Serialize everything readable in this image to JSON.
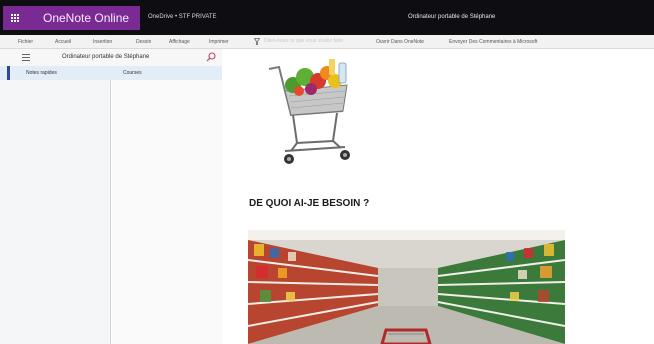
{
  "appbar": {
    "brand": "OneNote Online",
    "breadcrumb": "OneDrive • STF PRIVATE",
    "doc_title": "Ordinateur portable de Stéphane",
    "waffle_icon": "app-launcher-icon",
    "brand_color": "#7a2a93"
  },
  "ribbon": {
    "tabs": [
      "Fichier",
      "Accueil",
      "Insertion",
      "Dessin",
      "Affichage",
      "Imprimer"
    ],
    "tell_me_placeholder": "Dites-nous ce que vous voulez faire",
    "tell_me_icon": "lightbulb-icon",
    "commands": [
      "Ouvrir Dans OneNote",
      "Envoyer Des Commentaires à Microsoft"
    ]
  },
  "nav": {
    "notebook_name": "Ordinateur portable de Stéphane",
    "sections": [
      "Notes rapides"
    ],
    "pages": [
      "Courses"
    ],
    "menu_icon": "hamburger-icon",
    "search_icon": "search-icon"
  },
  "page": {
    "heading": "DE QUOI AI-JE BESOIN ?"
  }
}
